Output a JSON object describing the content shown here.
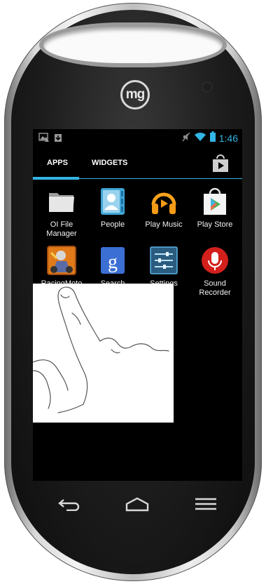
{
  "device": {
    "brand_logo": "mg"
  },
  "status_bar": {
    "time": "1:46",
    "icons": [
      "image-notification-icon",
      "download-notification-icon",
      "mute-icon",
      "wifi-icon",
      "battery-icon"
    ]
  },
  "tabs": [
    {
      "label": "APPS",
      "selected": true
    },
    {
      "label": "WIDGETS",
      "selected": false
    }
  ],
  "store_button": {
    "icon": "play-store-icon"
  },
  "apps": [
    {
      "label": "OI File\nManager",
      "icon": "folder-icon"
    },
    {
      "label": "People",
      "icon": "contacts-icon"
    },
    {
      "label": "Play Music",
      "icon": "headphones-icon"
    },
    {
      "label": "Play Store",
      "icon": "shopping-bag-icon"
    },
    {
      "label": "RacingMoto",
      "icon": "racing-game-icon"
    },
    {
      "label": "Search",
      "icon": "google-search-icon"
    },
    {
      "label": "Settings",
      "icon": "settings-sliders-icon"
    },
    {
      "label": "Sound\nRecorder",
      "icon": "microphone-icon"
    }
  ],
  "overlay": {
    "icon": "tap-gesture-hand-icon"
  },
  "nav_bar": {
    "buttons": [
      "back-icon",
      "home-icon",
      "recent-apps-icon"
    ]
  },
  "colors": {
    "accent": "#33b5e5",
    "screen_bg": "#000000"
  }
}
